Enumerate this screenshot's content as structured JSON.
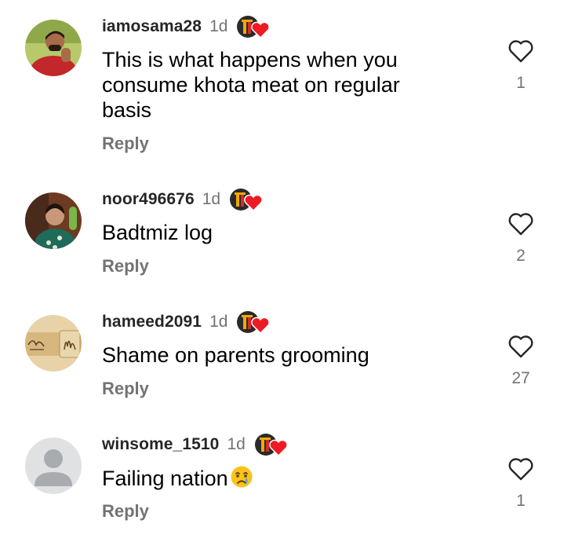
{
  "comments": [
    {
      "username": "iamosama28",
      "time": "1d",
      "text": [
        "This is what happens when you",
        "consume khota meat on regular",
        "basis"
      ],
      "reply_label": "Reply",
      "like_count": "1",
      "avatar": "man-red-shirt-photo"
    },
    {
      "username": "noor496676",
      "time": "1d",
      "text": [
        "Badtmiz log"
      ],
      "reply_label": "Reply",
      "like_count": "2",
      "avatar": "child-photo"
    },
    {
      "username": "hameed2091",
      "time": "1d",
      "text": [
        "Shame on parents grooming"
      ],
      "reply_label": "Reply",
      "like_count": "27",
      "avatar": "calligraphy-photo"
    },
    {
      "username": "winsome_1510",
      "time": "1d",
      "text": [
        "Failing nation"
      ],
      "text_emoji": "crying-face-emoji",
      "reply_label": "Reply",
      "like_count": "1",
      "avatar": "default-person-icon"
    }
  ],
  "colors": {
    "secondary_text": "#737373",
    "heart_badge": "#ed1c24",
    "like_outline": "#262626"
  },
  "icons": [
    "heart-outline-icon",
    "creator-heart-badge-icon"
  ]
}
